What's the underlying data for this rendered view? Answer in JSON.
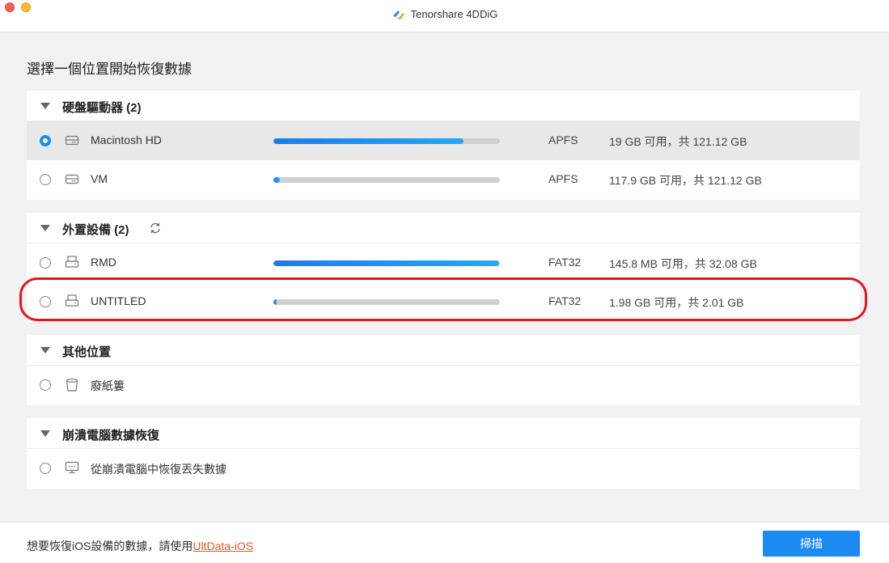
{
  "window": {
    "title": "Tenorshare 4DDiG"
  },
  "page_title": "選擇一個位置開始恢復數據",
  "sections": {
    "hard_drives": {
      "label": "硬盤驅動器 (2)",
      "items": [
        {
          "name": "Macintosh HD",
          "fs": "APFS",
          "capacity": "19 GB 可用，共 121.12 GB",
          "used_fraction": 0.84,
          "selected": true
        },
        {
          "name": "VM",
          "fs": "APFS",
          "capacity": "117.9 GB 可用，共 121.12 GB",
          "used_fraction": 0.03,
          "selected": false
        }
      ]
    },
    "external": {
      "label": "外置設備 (2)",
      "items": [
        {
          "name": "RMD",
          "fs": "FAT32",
          "capacity": "145.8 MB 可用，共 32.08 GB",
          "used_fraction": 0.995,
          "selected": false
        },
        {
          "name": "UNTITLED",
          "fs": "FAT32",
          "capacity": "1.98 GB 可用，共 2.01 GB",
          "used_fraction": 0.015,
          "selected": false
        }
      ]
    },
    "other": {
      "label": "其他位置",
      "items": [
        {
          "name": "廢紙簍"
        }
      ]
    },
    "crash": {
      "label": "崩潰電腦數據恢復",
      "items": [
        {
          "name": "從崩潰電腦中恢復丟失數據"
        }
      ]
    }
  },
  "footer": {
    "hint_prefix": "想要恢復iOS設備的數據，請使用",
    "hint_link": "UltData-iOS",
    "scan_label": "掃描"
  },
  "colors": {
    "accent": "#1b8bf1",
    "highlight": "#e5151b",
    "link": "#e8572a"
  }
}
